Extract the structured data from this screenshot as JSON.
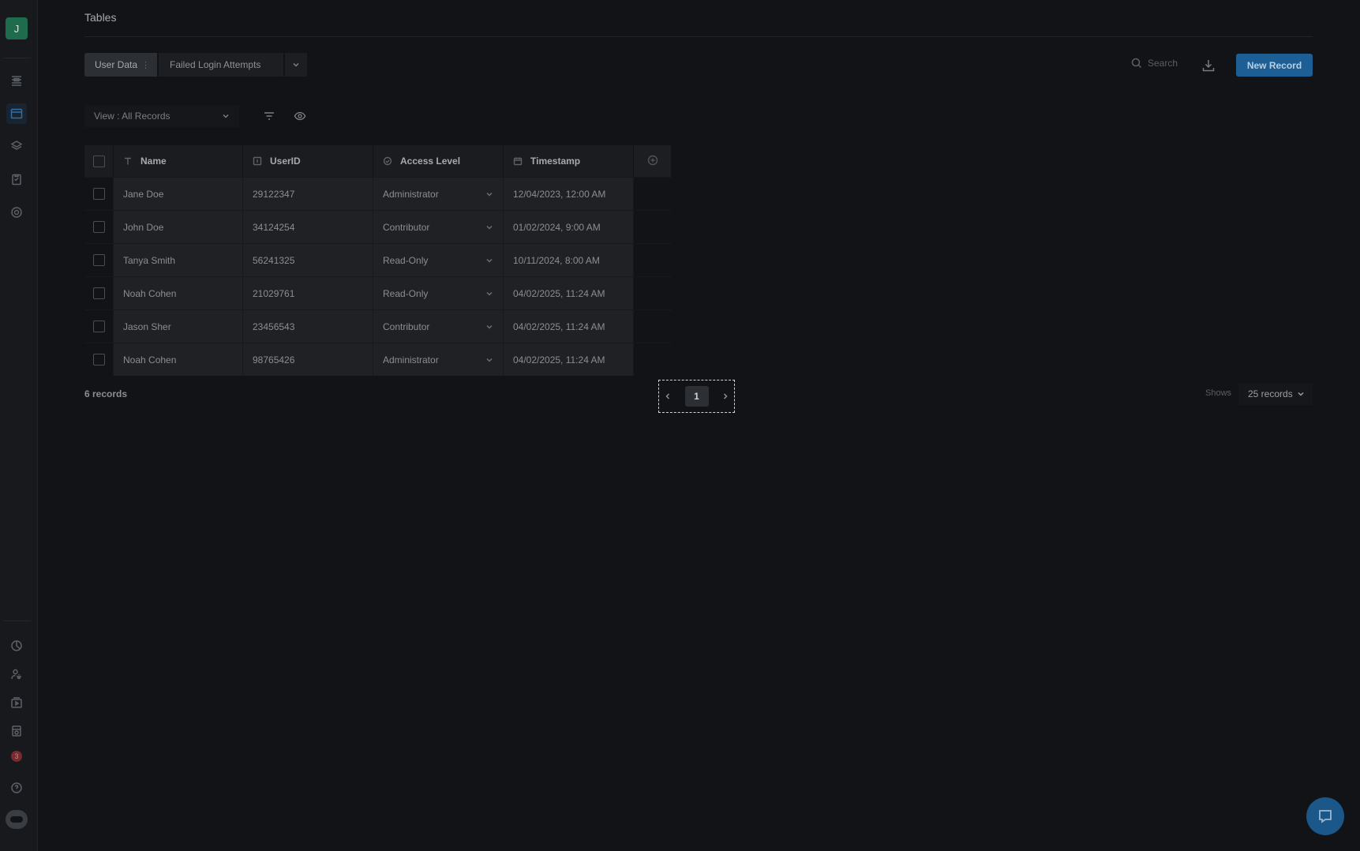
{
  "sidebar": {
    "avatar_initial": "J",
    "notification_count": "3",
    "top_icons": [
      "list-settings-icon",
      "table-icon",
      "layers-icon",
      "clipboard-icon",
      "target-icon"
    ],
    "bottom_icons": [
      "pie-chart-icon",
      "user-settings-icon",
      "media-icon",
      "database-icon",
      "notifications-icon",
      "help-icon",
      "bot-icon"
    ]
  },
  "header": {
    "title": "Tables"
  },
  "tabs": [
    {
      "label": "User Data",
      "active": true
    },
    {
      "label": "Failed Login Attempts",
      "active": false
    }
  ],
  "toolbar": {
    "search_placeholder": "Search",
    "new_record_label": "New Record"
  },
  "view": {
    "label": "View : All Records"
  },
  "table": {
    "columns": [
      "Name",
      "UserID",
      "Access Level",
      "Timestamp"
    ],
    "rows": [
      {
        "name": "Jane Doe",
        "userid": "29122347",
        "access": "Administrator",
        "timestamp": "12/04/2023, 12:00 AM"
      },
      {
        "name": "John Doe",
        "userid": "34124254",
        "access": "Contributor",
        "timestamp": "01/02/2024, 9:00 AM"
      },
      {
        "name": "Tanya Smith",
        "userid": "56241325",
        "access": "Read-Only",
        "timestamp": "10/11/2024, 8:00 AM"
      },
      {
        "name": "Noah Cohen",
        "userid": "21029761",
        "access": "Read-Only",
        "timestamp": "04/02/2025, 11:24 AM"
      },
      {
        "name": "Jason Sher",
        "userid": "23456543",
        "access": "Contributor",
        "timestamp": "04/02/2025, 11:24 AM"
      },
      {
        "name": "Noah Cohen",
        "userid": "98765426",
        "access": "Administrator",
        "timestamp": "04/02/2025, 11:24 AM"
      }
    ]
  },
  "footer": {
    "records_count": "6 records",
    "current_page": "1",
    "shows_label": "Shows",
    "per_page": "25 records"
  },
  "colors": {
    "accent": "#1d5f94",
    "background": "#111316"
  }
}
